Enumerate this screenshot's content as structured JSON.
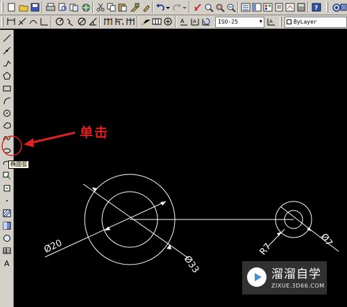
{
  "toolbar_standard": {
    "icons": [
      "new-icon",
      "open-icon",
      "save-icon",
      "print-icon",
      "plot-preview-icon",
      "publish-icon",
      "3d-dwf-icon",
      "cut-icon",
      "copy-icon",
      "paste-icon",
      "match-properties-icon",
      "undo-icon",
      "redo-icon",
      "pan-icon",
      "zoom-realtime-icon",
      "zoom-window-icon",
      "zoom-previous-icon",
      "properties-icon",
      "design-center-icon",
      "tool-palettes-icon",
      "sheet-set-icon",
      "markup-icon",
      "calculator-icon",
      "help-icon"
    ]
  },
  "toolbar_dimension": {
    "icons": [
      "linear-dim-icon",
      "aligned-dim-icon",
      "arc-length-icon",
      "ordinate-icon",
      "radius-dim-icon",
      "jogged-icon",
      "diameter-dim-icon",
      "angular-dim-icon",
      "quick-dim-icon",
      "baseline-icon",
      "continue-icon",
      "quick-leader-icon",
      "tolerance-icon",
      "center-mark-icon",
      "dim-edit-icon",
      "dim-text-edit-icon",
      "dim-update-icon"
    ],
    "dimstyle_value": "ISO-25",
    "layer_value": "ByLayer"
  },
  "palette": {
    "tools": [
      "line-icon",
      "construction-line-icon",
      "polyline-icon",
      "polygon-icon",
      "rectangle-icon",
      "arc-icon",
      "circle-icon",
      "revision-cloud-icon",
      "spline-icon",
      "ellipse-icon",
      "ellipse-arc-icon",
      "insert-block-icon",
      "make-block-icon",
      "point-icon",
      "hatch-icon",
      "gradient-icon",
      "region-icon",
      "table-icon",
      "multiline-text-icon"
    ],
    "tooltip": "椭圆弧"
  },
  "annotation": {
    "text": "单击",
    "color": "#e02020"
  },
  "drawing": {
    "dim_large_diameter": "Ø20",
    "dim_outer_diameter": "Ø33",
    "dim_small_radius": "R7",
    "dim_small_diameter": "Ø7"
  },
  "watermark": {
    "title": "溜溜自学",
    "url": "ZIXUE.3D66.COM"
  }
}
